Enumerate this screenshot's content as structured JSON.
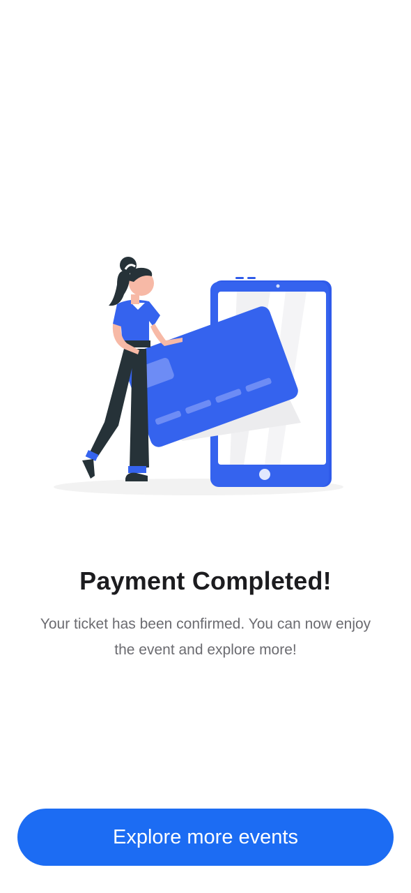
{
  "illustration": {
    "icon": "woman-holding-card-phone-illustration",
    "accent_color": "#2f5bea"
  },
  "confirmation": {
    "title": "Payment Completed!",
    "message": "Your ticket has been confirmed. You can now enjoy the event and explore more!"
  },
  "actions": {
    "explore_label": "Explore more events",
    "button_color": "#1c6cf3"
  }
}
